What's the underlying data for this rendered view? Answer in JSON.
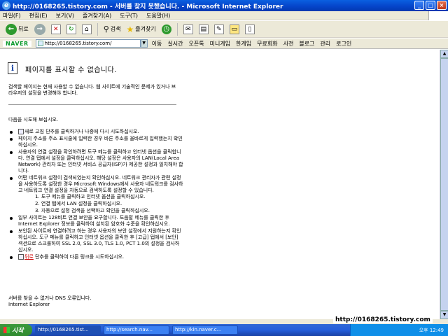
{
  "window": {
    "title": "http://0168265.tistory.com - 서버를 찾지 못했습니다. - Microsoft Internet Explorer"
  },
  "menu": [
    "파일(F)",
    "편집(E)",
    "보기(V)",
    "즐겨찾기(A)",
    "도구(T)",
    "도움말(H)"
  ],
  "toolbar": {
    "back": "뒤로",
    "search": "검색",
    "favorites": "즐겨찾기"
  },
  "address": {
    "logo": "NAVER",
    "url": "http://0168265.tistory.com/",
    "go": "이동",
    "items": [
      "실시간",
      "오픈톡",
      "미니게임",
      "한게임",
      "무료회화",
      "사전",
      "블로그",
      "관리",
      "로그인"
    ]
  },
  "page": {
    "title": "페이지를 표시할 수 없습니다.",
    "intro": "검색할 페이지는 현재 사용할 수 없습니다. 웹 사이트에 기술적인 문제가 있거나 브라우저의 설정을 변경해야 합니다.",
    "try": "다음을 시도해 보십시오.",
    "bullet1": "새로 고침 단추를 클릭하거나 나중에 다시 시도하십시오.",
    "bullet2": "페이지 주소를 주소 표시줄에 입력한 경우 바른 주소를 올바르게 입력했는지 확인하십시오.",
    "bullet3": "사용자의 연결 설정을 확인하려면 도구 메뉴를 클릭하고 인터넷 옵션을 클릭합니다. 연결 탭에서 설정을 클릭하십시오. 해당 설정은 사용자의 LAN(Local Area Network) 관리자 또는 인터넷 서비스 공급자(ISP)가 제공한 설정과 일치해야 합니다.",
    "bullet4": "어떤 네트워크 설정이 검색되었는지 확인하십시오. 네트워크 관리자가 관련 설정을 사용하도록 설정한 경우 Microsoft Windows에서 사용자 네트워크를 검사하고 네트워크 연결 설정을 자동으로 검색하도록 설정할 수 있습니다.",
    "sub1": "1.  도구 메뉴를 클릭하고 인터넷 옵션을 클릭하십시오.",
    "sub2": "2.  연결 탭에서 LAN 설정을 클릭하십시오.",
    "sub3": "3.  자동으로 설정 검색을 선택하고 확인을 클릭하십시오.",
    "bullet5": "일부 사이트는 128비트 연결 보안을 요구합니다. 도움말 메뉴를 클릭한 후 Internet Explorer 정보를 클릭하여 설치된 암호화 수준을 확인하십시오.",
    "bullet6": "보안된 사이트에 연결하려고 하는 경우 사용자의 보안 설정에서 지원하는지 확인하십시오. 도구 메뉴를 클릭하고 인터넷 옵션을 클릭한 후 [고급] 탭에서 [보안] 섹션으로 스크롤하여 SSL 2.0, SSL 3.0, TLS 1.0, PCT 1.0의 설정을 검사하십시오.",
    "bullet7_pre": "",
    "bullet7_link": "뒤로",
    "bullet7_post": " 단추를 클릭하여 다른 링크를 시도하십시오.",
    "footer1": "서버를 찾을 수 없거나 DNS 오류입니다.",
    "footer2": "Internet Explorer"
  },
  "taskbar": {
    "start": "시작",
    "tasks": [
      "http://0168265.tist...",
      "http://search.nav...",
      "http://kin.naver.c..."
    ],
    "clock": "오후 12:49"
  },
  "watermark": "http://0168265.tistory.com"
}
